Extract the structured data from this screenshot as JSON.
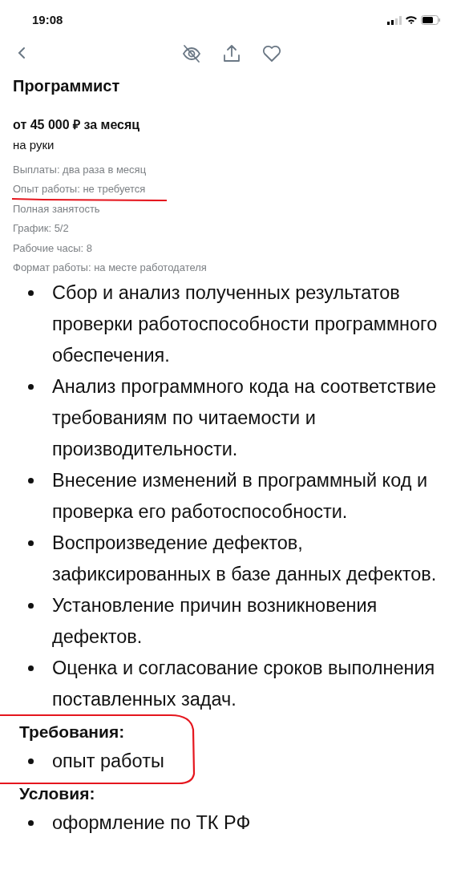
{
  "status_bar": {
    "time": "19:08"
  },
  "title": "Программист",
  "salary": "от 45 000 ₽ за месяц",
  "salary_note": "на руки",
  "details": [
    {
      "text": "Выплаты: два раза в месяц",
      "underlined": false
    },
    {
      "text": "Опыт работы: не требуется",
      "underlined": true
    },
    {
      "text": "Полная занятость",
      "underlined": false
    },
    {
      "text": "График: 5/2",
      "underlined": false
    },
    {
      "text": "Рабочие часы: 8",
      "underlined": false
    },
    {
      "text": "Формат работы: на месте работодателя",
      "underlined": false
    }
  ],
  "sections": [
    {
      "circled": false,
      "items": [
        "Сбор и анализ полученных результатов проверки работоспособности программного обеспечения.",
        "Анализ программного кода на соответствие требованиям по читаемости и производительности.",
        "Внесение изменений в программный код и проверка его работоспособности.",
        "Воспроизведение дефектов, зафиксированных в базе данных дефектов.",
        "Установление причин возникновения дефектов.",
        "Оценка и согласование сроков выполнения поставленных задач."
      ]
    },
    {
      "heading": "Требования:",
      "circled": true,
      "items": [
        "опыт работы"
      ]
    },
    {
      "heading": "Условия:",
      "circled": false,
      "items": [
        "оформление по ТК РФ"
      ]
    }
  ]
}
